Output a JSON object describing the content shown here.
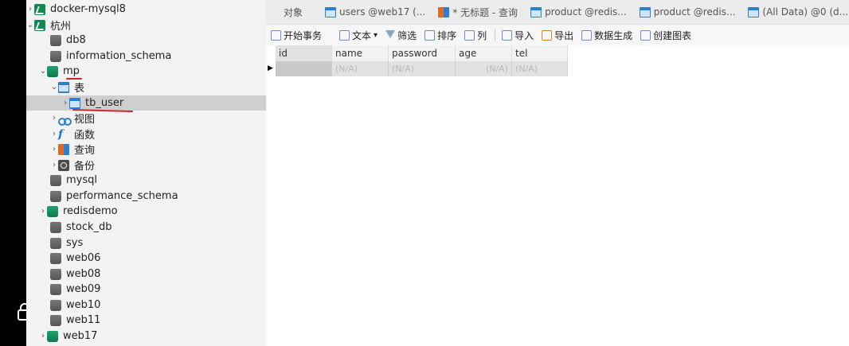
{
  "sidebar": {
    "items": [
      {
        "label": "docker-mysql8",
        "icon": "connection-icon",
        "chevron": "›"
      },
      {
        "label": "杭州",
        "icon": "connection-icon",
        "chevron": "⌄"
      },
      {
        "label": "db8",
        "icon": "database-icon",
        "chevron": ""
      },
      {
        "label": "information_schema",
        "icon": "database-icon",
        "chevron": ""
      },
      {
        "label": "mp",
        "icon": "database-open-icon",
        "chevron": "⌄"
      },
      {
        "label": "表",
        "icon": "tables-folder-icon",
        "chevron": "⌄"
      },
      {
        "label": "tb_user",
        "icon": "table-icon",
        "chevron": "›"
      },
      {
        "label": "视图",
        "icon": "views-icon",
        "chevron": "›"
      },
      {
        "label": "函数",
        "icon": "function-icon",
        "chevron": "›"
      },
      {
        "label": "查询",
        "icon": "query-icon",
        "chevron": "›"
      },
      {
        "label": "备份",
        "icon": "backup-icon",
        "chevron": "›"
      },
      {
        "label": "mysql",
        "icon": "database-icon",
        "chevron": ""
      },
      {
        "label": "performance_schema",
        "icon": "database-icon",
        "chevron": ""
      },
      {
        "label": "redisdemo",
        "icon": "database-open-icon",
        "chevron": "›"
      },
      {
        "label": "stock_db",
        "icon": "database-icon",
        "chevron": ""
      },
      {
        "label": "sys",
        "icon": "database-icon",
        "chevron": ""
      },
      {
        "label": "web06",
        "icon": "database-icon",
        "chevron": ""
      },
      {
        "label": "web08",
        "icon": "database-icon",
        "chevron": ""
      },
      {
        "label": "web09",
        "icon": "database-icon",
        "chevron": ""
      },
      {
        "label": "web10",
        "icon": "database-icon",
        "chevron": ""
      },
      {
        "label": "web11",
        "icon": "database-icon",
        "chevron": ""
      },
      {
        "label": "web17",
        "icon": "database-open-icon",
        "chevron": "›"
      }
    ]
  },
  "tabs": [
    {
      "label": "对象",
      "icon": ""
    },
    {
      "label": "users @web17 (...",
      "icon": "table-icon"
    },
    {
      "label": "* 无标题 - 查询",
      "icon": "query-icon"
    },
    {
      "label": "product @redis...",
      "icon": "table-icon"
    },
    {
      "label": "product @redis...",
      "icon": "table-icon"
    },
    {
      "label": "(All Data) @0 (d...",
      "icon": "table-icon"
    }
  ],
  "toolbar": {
    "begin_transaction": "开始事务",
    "text": "文本",
    "text_dropdown": "▾",
    "filter": "筛选",
    "sort": "排序",
    "columns": "列",
    "import": "导入",
    "export": "导出",
    "data_generation": "数据生成",
    "create_chart": "创建图表"
  },
  "grid": {
    "columns": [
      "id",
      "name",
      "password",
      "age",
      "tel"
    ],
    "row_marker": "▶",
    "rows": [
      [
        "",
        "(N/A)",
        "(N/A)",
        "(N/A)",
        "(N/A)"
      ]
    ]
  },
  "colors": {
    "selection": "#cfcfcf",
    "annotation_red": "#d0262f",
    "connection_green": "#0f8b4f",
    "table_blue": "#2d7fd1"
  }
}
